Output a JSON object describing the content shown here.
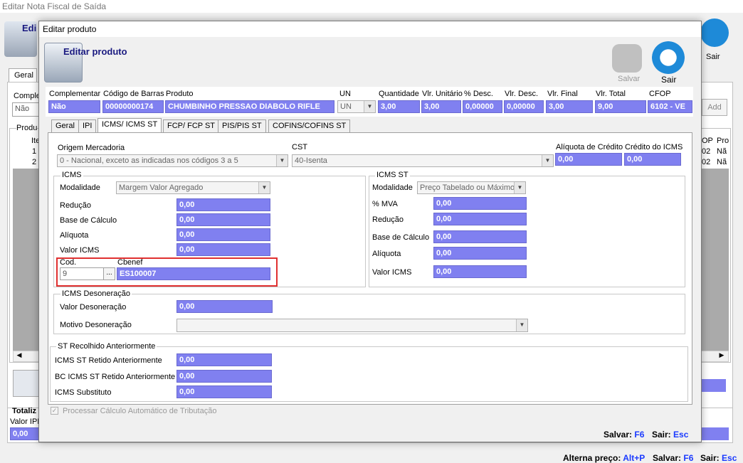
{
  "bg": {
    "title": "Editar Nota Fiscal de Saída",
    "header_partial": "Edi",
    "sair": "Sair",
    "tab_geral": "Geral",
    "compl_label": "Complem",
    "compl_value": "Não",
    "produtos_label": "Produ",
    "col_item": "Ite",
    "row1": "1",
    "row2": "2",
    "col_dp": "OP",
    "col_pr": "Pro",
    "cell_nao1": "Nã",
    "cell_nao2": "Nã",
    "cell_02a": "02",
    "cell_02b": "02",
    "add": "Add",
    "totaliz": "Totaliz",
    "valor_ipi": "Valor IPI",
    "valor_ipi_value": "0,00",
    "footer_alterna": "Alterna preço:",
    "footer_alterna_key": "Alt+P",
    "footer_salvar": "Salvar:",
    "footer_salvar_key": "F6",
    "footer_sair": "Sair:",
    "footer_sair_key": "Esc"
  },
  "dialog": {
    "title": "Editar produto",
    "header": "Editar produto",
    "salvar": "Salvar",
    "sair": "Sair",
    "footer_salvar": "Salvar:",
    "footer_salvar_key": "F6",
    "footer_sair": "Sair:",
    "footer_sair_key": "Esc"
  },
  "top": {
    "complementar_label": "Complementar",
    "complementar": "Não",
    "codigo_label": "Código de Barras",
    "codigo": "00000000174",
    "produto_label": "Produto",
    "produto": "CHUMBINHO PRESSAO DIABOLO RIFLE",
    "un_label": "UN",
    "un": "UN",
    "quantidade_label": "Quantidade",
    "quantidade": "3,00",
    "vlr_unit_label": "Vlr. Unitário",
    "vlr_unit": "3,00",
    "desc_pct_label": "% Desc.",
    "desc_pct": "0,00000",
    "vlr_desc_label": "Vlr. Desc.",
    "vlr_desc": "0,00000",
    "vlr_final_label": "Vlr. Final",
    "vlr_final": "3,00",
    "vlr_total_label": "Vlr. Total",
    "vlr_total": "9,00",
    "cfop_label": "CFOP",
    "cfop": "6102 - VE"
  },
  "tabs": [
    "Geral",
    "IPI",
    "ICMS/ ICMS ST",
    "FCP/ FCP ST",
    "PIS/PIS ST",
    "COFINS/COFINS ST"
  ],
  "icms_tab": {
    "origem_label": "Origem Mercadoria",
    "origem": "0 - Nacional, exceto as indicadas nos códigos 3 a 5",
    "cst_label": "CST",
    "cst": "40-Isenta",
    "aliq_cred_label": "Alíquota de Crédito",
    "aliq_cred": "0,00",
    "cred_icms_label": "Crédito do ICMS",
    "cred_icms": "0,00"
  },
  "icms": {
    "title": "ICMS",
    "modalidade_label": "Modalidade",
    "modalidade": "Margem Valor Agregado",
    "reducao_label": "Redução",
    "reducao": "0,00",
    "base_label": "Base de Cálculo",
    "base": "0,00",
    "aliquota_label": "Alíquota",
    "aliquota": "0,00",
    "valor_label": "Valor ICMS",
    "valor": "0,00",
    "cod_label": "Cod.",
    "cod": "9",
    "cod_btn": "...",
    "cbenef_label": "Cbenef",
    "cbenef": "ES100007"
  },
  "icms_st": {
    "title": "ICMS ST",
    "modalidade_label": "Modalidade",
    "modalidade": "Preço Tabelado ou Máximo",
    "mva_label": "% MVA",
    "mva": "0,00",
    "reducao_label": "Redução",
    "reducao": "0,00",
    "base_label": "Base de Cálculo",
    "base": "0,00",
    "aliquota_label": "Alíquota",
    "aliquota": "0,00",
    "valor_label": "Valor ICMS",
    "valor": "0,00"
  },
  "deson": {
    "title": "ICMS Desoneração",
    "valor_label": "Valor Desoneração",
    "valor": "0,00",
    "motivo_label": "Motivo Desoneração",
    "motivo": ""
  },
  "st_ret": {
    "title": "ST Recolhido Anteriormente",
    "st_label": "ICMS ST Retido Anteriormente",
    "st": "0,00",
    "bc_label": "BC ICMS ST Retido Anteriormente",
    "bc": "0,00",
    "subst_label": "ICMS Substituto",
    "subst": "0,00"
  },
  "processar": "Processar Cálculo Automático de Tributação"
}
